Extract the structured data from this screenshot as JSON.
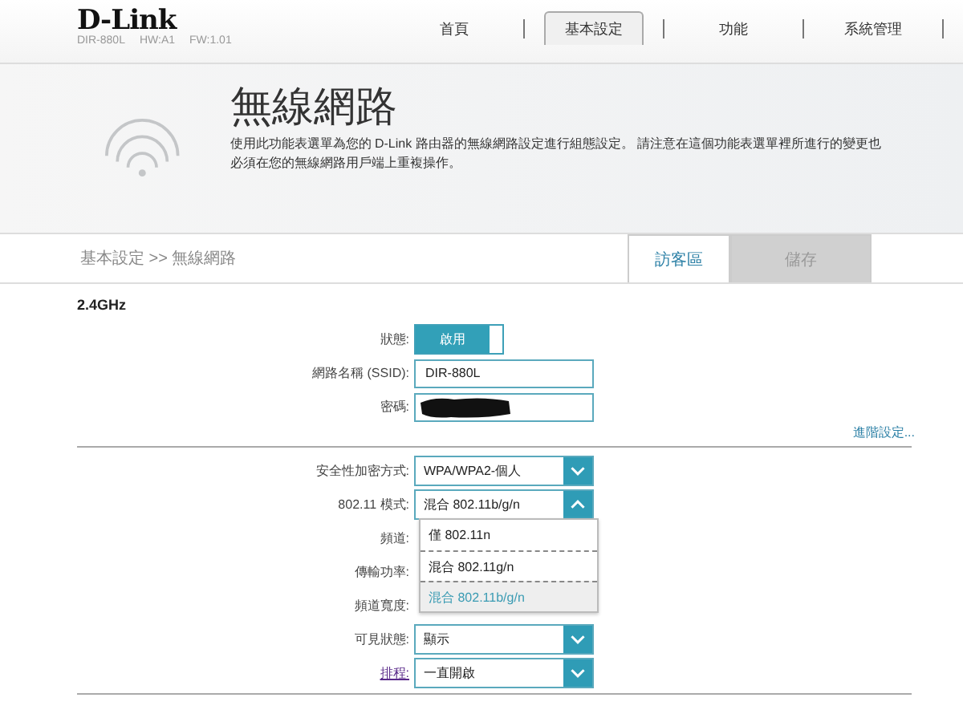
{
  "brand": {
    "logo": "D-Link",
    "model": "DIR-880L",
    "hw": "HW:A1",
    "fw": "FW:1.01"
  },
  "nav": [
    {
      "label": "首頁",
      "selected": false
    },
    {
      "label": "基本設定",
      "selected": true
    },
    {
      "label": "功能",
      "selected": false
    },
    {
      "label": "系統管理",
      "selected": false
    }
  ],
  "banner": {
    "title": "無線網路",
    "description": "使用此功能表選單為您的 D-Link 路由器的無線網路設定進行組態設定。 請注意在這個功能表選單裡所進行的變更也必須在您的無線網路用戶端上重複操作。"
  },
  "breadcrumb": "基本設定 >> 無線網路",
  "actions": [
    {
      "label": "訪客區",
      "kind": "link"
    },
    {
      "label": "儲存",
      "kind": "disabled"
    }
  ],
  "section": "2.4GHz",
  "basic": [
    {
      "label": "狀態:",
      "kind": "toggle",
      "value": "啟用",
      "on": true
    },
    {
      "label": "網路名稱 (SSID):",
      "kind": "text",
      "value": "DIR-880L"
    },
    {
      "label": "密碼:",
      "kind": "redacted"
    }
  ],
  "advanced_link": "進階設定...",
  "advanced": [
    {
      "label": "安全性加密方式:",
      "kind": "select",
      "value": "WPA/WPA2-個人",
      "expanded": false
    },
    {
      "label": "802.11 模式:",
      "kind": "select",
      "value": "混合 802.11b/g/n",
      "expanded": true,
      "options": [
        {
          "label": "僅 802.11n",
          "selected": false
        },
        {
          "label": "混合 802.11g/n",
          "selected": false
        },
        {
          "label": "混合 802.11b/g/n",
          "selected": true
        }
      ]
    },
    {
      "label": "頻道:",
      "kind": "hidden"
    },
    {
      "label": "傳輸功率:",
      "kind": "hidden"
    },
    {
      "label": "頻道寬度:",
      "kind": "hidden"
    },
    {
      "label": "可見狀態:",
      "kind": "select",
      "value": "顯示",
      "expanded": false
    },
    {
      "label": "排程:",
      "kind": "select",
      "value": "一直開啟",
      "expanded": false,
      "link": true
    }
  ]
}
